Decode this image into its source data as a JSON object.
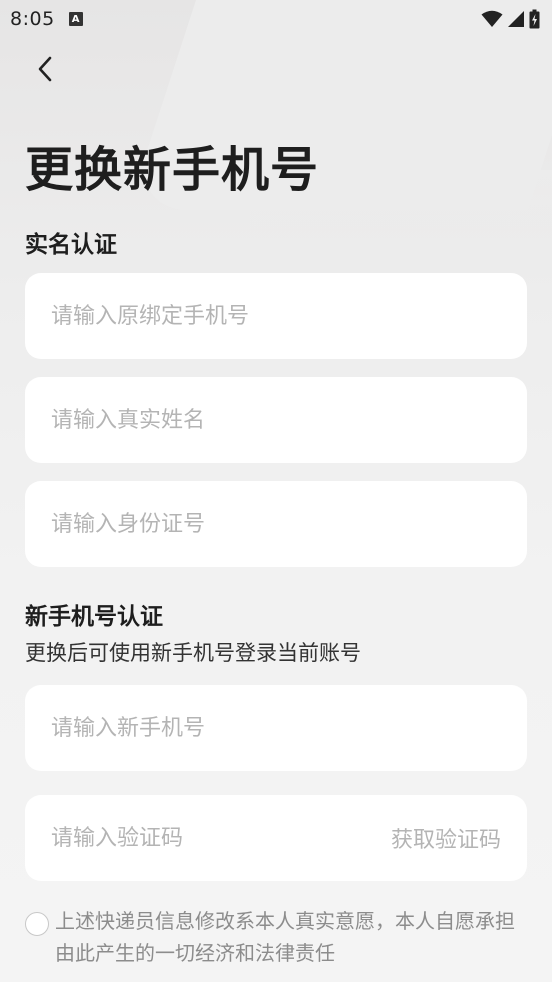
{
  "status": {
    "time": "8:05",
    "badge": "A"
  },
  "page": {
    "title": "更换新手机号"
  },
  "realname_section": {
    "title": "实名认证",
    "fields": [
      {
        "placeholder": "请输入原绑定手机号",
        "value": ""
      },
      {
        "placeholder": "请输入真实姓名",
        "value": ""
      },
      {
        "placeholder": "请输入身份证号",
        "value": ""
      }
    ]
  },
  "newphone_section": {
    "title": "新手机号认证",
    "subtitle": "更换后可使用新手机号登录当前账号",
    "phone_field": {
      "placeholder": "请输入新手机号",
      "value": ""
    },
    "code_field": {
      "placeholder": "请输入验证码",
      "value": ""
    },
    "get_code_label": "获取验证码"
  },
  "agreement": {
    "checked": false,
    "text": "上述快递员信息修改系本人真实意愿，本人自愿承担由此产生的一切经济和法律责任"
  },
  "colors": {
    "background": "#f2f1f1",
    "field_bg": "#ffffff",
    "title_text": "#1e1e1e",
    "placeholder": "#b4b4b4",
    "muted_text": "#8c8c8c"
  }
}
